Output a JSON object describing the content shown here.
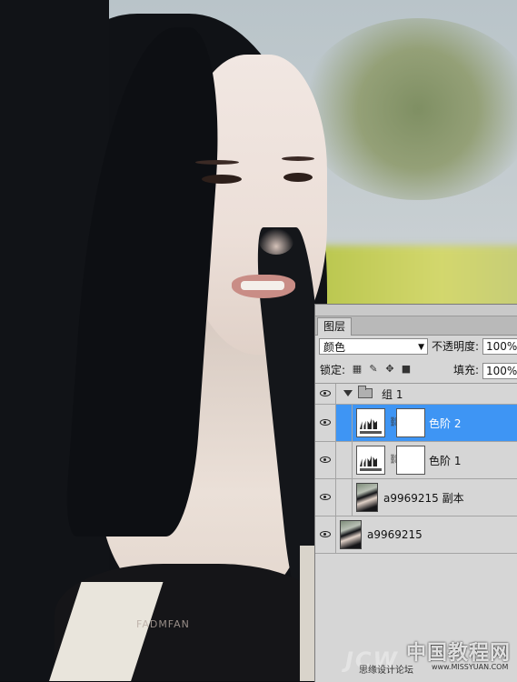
{
  "photo": {
    "signature": "FADMFAN"
  },
  "layers_panel": {
    "tab_label": "图层",
    "blend_mode": "颜色",
    "opacity_label": "不透明度:",
    "opacity_value": "100%",
    "lock_label": "锁定:",
    "fill_label": "填充:",
    "fill_value": "100%",
    "layers": [
      {
        "name": "组 1",
        "kind": "group",
        "visible": true,
        "selected": false
      },
      {
        "name": "色阶 2",
        "kind": "levels-adjustment",
        "visible": true,
        "selected": true
      },
      {
        "name": "色阶 1",
        "kind": "levels-adjustment",
        "visible": true,
        "selected": false
      },
      {
        "name": "a9969215 副本",
        "kind": "image",
        "visible": true,
        "selected": false
      },
      {
        "name": "a9969215",
        "kind": "image",
        "visible": true,
        "selected": false
      }
    ]
  },
  "watermark": {
    "title": "中国教程网",
    "brand": "JCW",
    "forum": "思缘设计论坛",
    "site": "www.MISSYUAN.COM"
  },
  "colors": {
    "selection": "#3e95f4",
    "panel_bg": "#d6d6d6"
  }
}
